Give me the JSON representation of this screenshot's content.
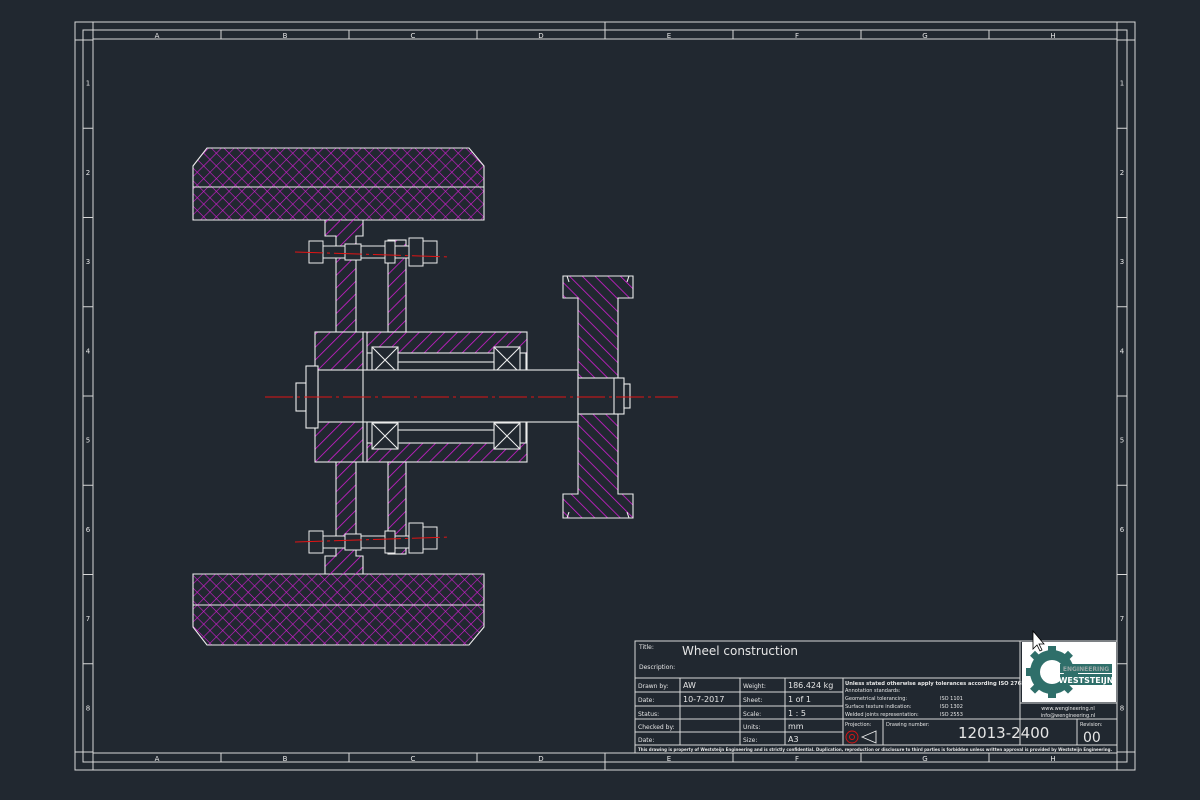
{
  "sheet": {
    "columns": [
      "A",
      "B",
      "C",
      "D",
      "E",
      "F",
      "G",
      "H"
    ],
    "rows": [
      "1",
      "2",
      "3",
      "4",
      "5",
      "6",
      "7",
      "8"
    ]
  },
  "title_block": {
    "title_label": "Title:",
    "title": "Wheel construction",
    "description_label": "Description:",
    "drawn_by_label": "Drawn by:",
    "drawn_by": "AW",
    "date_label": "Date:",
    "date": "10-7-2017",
    "status_label": "Status:",
    "checked_by_label": "Checked by:",
    "date2_label": "Date:",
    "weight_label": "Weight:",
    "weight": "186.424 kg",
    "sheet_label": "Sheet:",
    "sheet": "1 of 1",
    "scale_label": "Scale:",
    "scale": "1 : 5",
    "units_label": "Units:",
    "units": "mm",
    "size_label": "Size:",
    "size": "A3",
    "notes_heading": "Unless stated otherwise apply tolerances according ISO 2768mK",
    "standards_heading": "Annotation standards:",
    "standards": [
      {
        "label": "Geometrical tolerancing:",
        "value": "ISO 1101"
      },
      {
        "label": "Surface texture indication:",
        "value": "ISO 1302"
      },
      {
        "label": "Welded joints representation:",
        "value": "ISO 2553"
      }
    ],
    "projection_label": "Projection:",
    "drawing_number_label": "Drawing number:",
    "drawing_number": "12013-2400",
    "revision_label": "Revision:",
    "revision": "00",
    "website": "www.wengineering.nl",
    "email": "info@wengineering.nl",
    "logo_text": "WESTSTEIJN",
    "logo_subtext": "ENGINEERING",
    "footer": "This drawing is property of Weststeijn Engineering and is strictly confidential. Duplication, reproduction or disclosure to third parties is forbidden unless written approval is provided by Weststeijn Engineering."
  },
  "colors": {
    "background": "#212830",
    "line": "#e8e8e8",
    "hatch": "#d21ed2",
    "centerline": "#e01414",
    "logo_green": "#2f6f6a"
  }
}
